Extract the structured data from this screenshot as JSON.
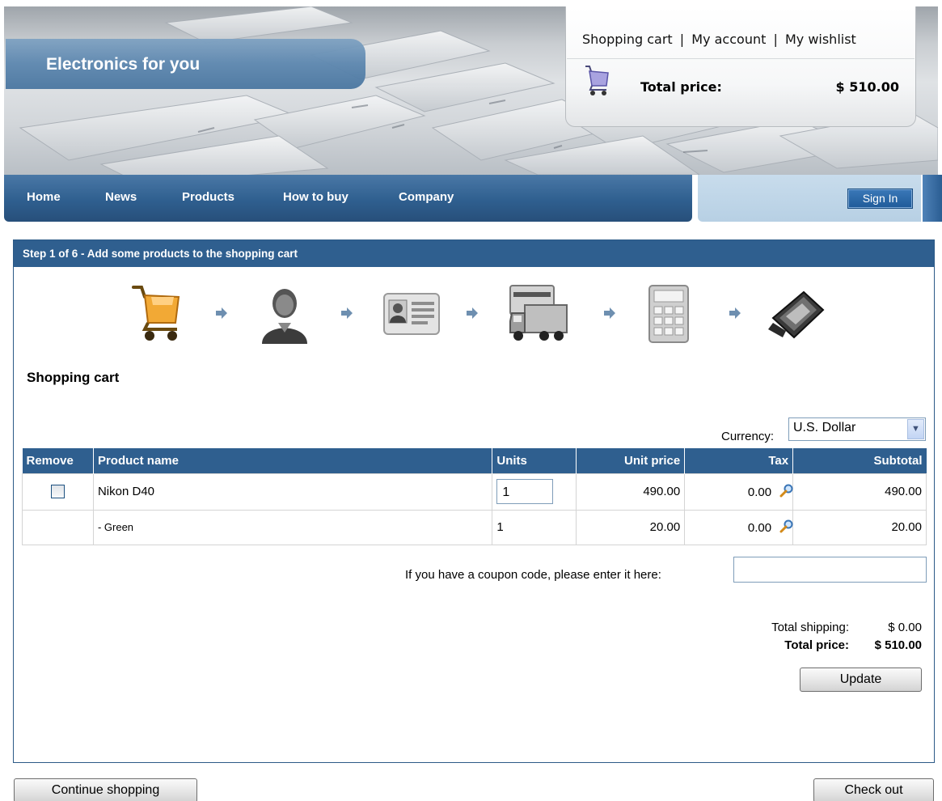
{
  "header": {
    "site_title": "Electronics for you",
    "minicart": {
      "links": [
        "Shopping cart",
        "My account",
        "My wishlist"
      ],
      "separator": "|",
      "total_label": "Total price:",
      "total_value": "$ 510.00"
    }
  },
  "nav": {
    "items": [
      "Home",
      "News",
      "Products",
      "How to buy",
      "Company"
    ],
    "sign_in": "Sign In"
  },
  "checkout": {
    "step_text": "Step 1 of 6 - Add some products to the shopping cart",
    "steps": [
      "cart-step-icon",
      "customer-step-icon",
      "address-step-icon",
      "shipping-step-icon",
      "calculator-step-icon",
      "payment-step-icon"
    ],
    "section_title": "Shopping cart",
    "currency_label": "Currency:",
    "currency_value": "U.S. Dollar",
    "table": {
      "headers": [
        "Remove",
        "Product name",
        "Units",
        "Unit price",
        "Tax",
        "Subtotal"
      ],
      "rows": [
        {
          "name": "Nikon D40",
          "units": "1",
          "unit_price": "490.00",
          "tax": "0.00",
          "subtotal": "490.00"
        },
        {
          "name": "- Green",
          "units": "1",
          "unit_price": "20.00",
          "tax": "0.00",
          "subtotal": "20.00"
        }
      ]
    },
    "coupon_label": "If you have a coupon code, please enter it here:",
    "coupon_value": "",
    "totals": {
      "shipping_label": "Total shipping:",
      "shipping_value": "$ 0.00",
      "price_label": "Total price:",
      "price_value": "$ 510.00"
    },
    "update_button": "Update"
  },
  "footer": {
    "continue_button": "Continue shopping",
    "checkout_button": "Check out"
  },
  "colors": {
    "primary_blue": "#2f5f8f",
    "signin_area": "#c8dcec"
  }
}
